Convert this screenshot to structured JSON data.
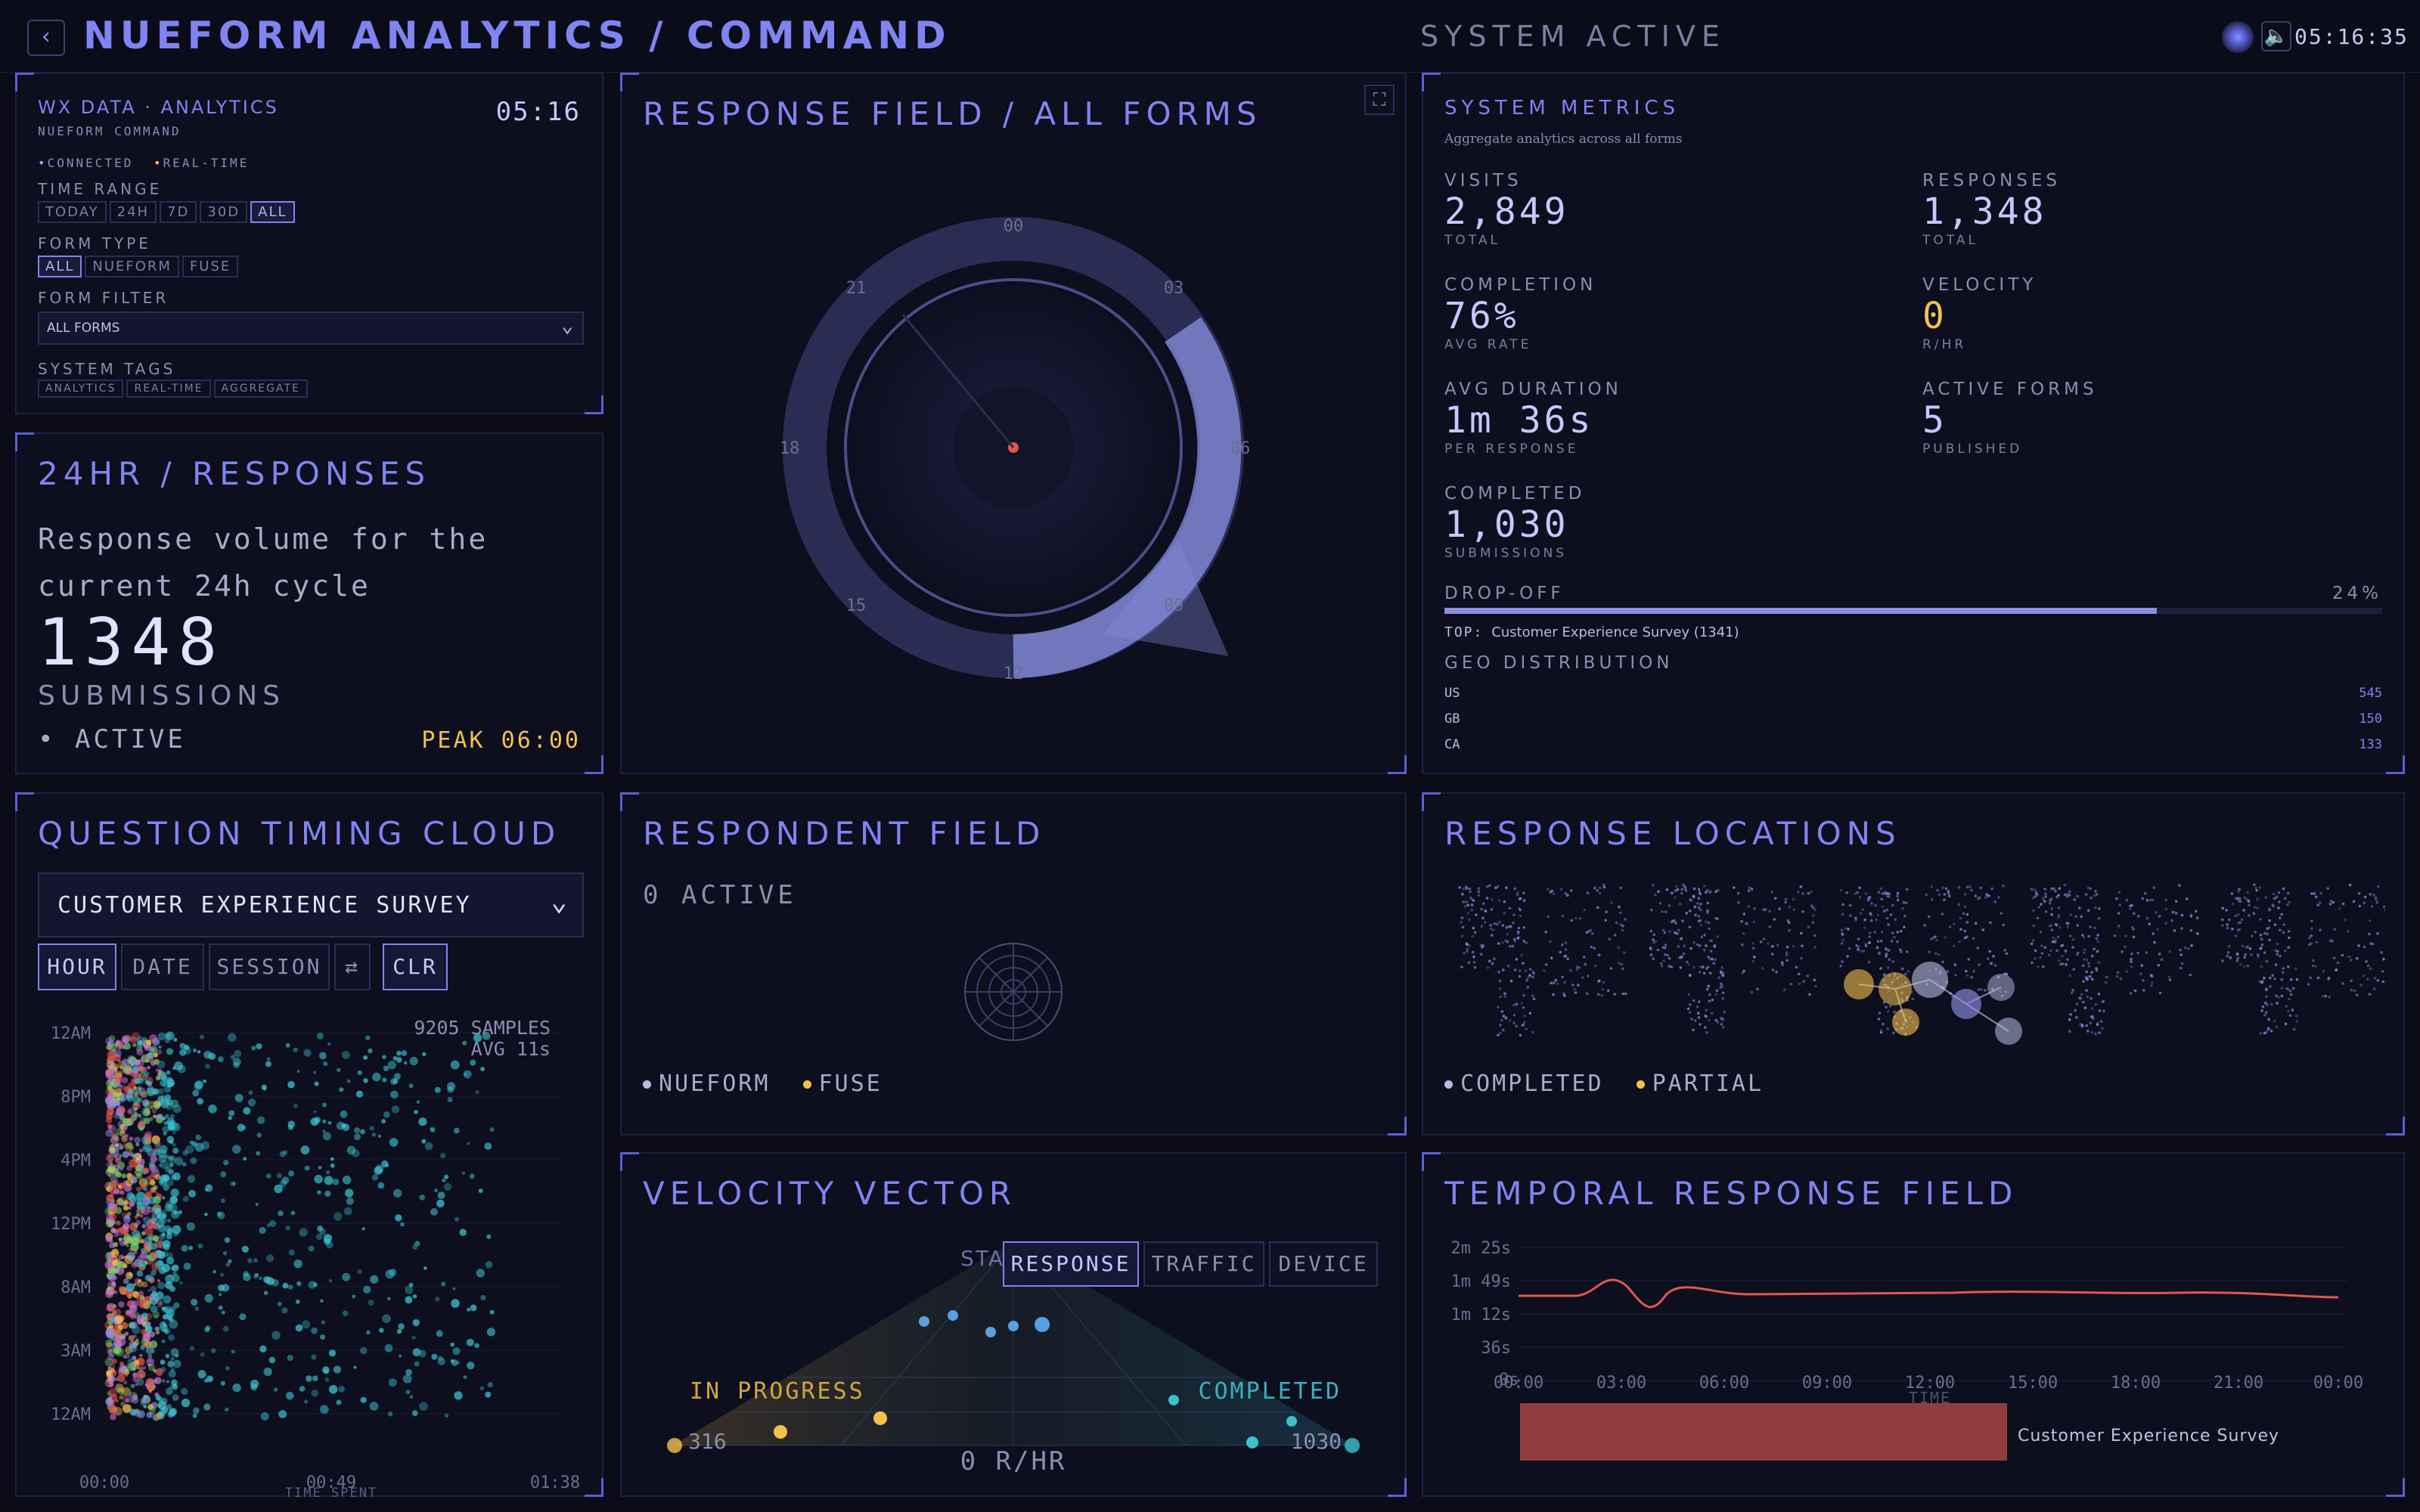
{
  "header": {
    "back_icon": "‹",
    "title": "NUEFORM ANALYTICS / COMMAND",
    "status": "SYSTEM ACTIVE",
    "clock": "05:16:35"
  },
  "control": {
    "title": "WX DATA · ANALYTICS",
    "subtitle": "NUEFORM COMMAND",
    "time": "05:16",
    "status_connected": "CONNECTED",
    "status_realtime": "REAL-TIME",
    "time_range_label": "TIME RANGE",
    "time_ranges": [
      "TODAY",
      "24H",
      "7D",
      "30D",
      "ALL"
    ],
    "form_type_label": "FORM TYPE",
    "form_types": [
      "ALL",
      "NUEFORM",
      "FUSE"
    ],
    "form_filter_label": "FORM FILTER",
    "form_filter_value": "ALL FORMS",
    "tags_label": "SYSTEM TAGS",
    "tags": [
      "ANALYTICS",
      "REAL-TIME",
      "AGGREGATE"
    ]
  },
  "responses24": {
    "title": "24HR / RESPONSES",
    "desc1": "Response volume for the",
    "desc2": "current 24h cycle",
    "count": "1348",
    "unit": "SUBMISSIONS",
    "status": "ACTIVE",
    "peak": "PEAK 06:00"
  },
  "field": {
    "title": "RESPONSE FIELD / ALL FORMS",
    "hours": [
      "00",
      "03",
      "06",
      "09",
      "12",
      "15",
      "18",
      "21"
    ]
  },
  "metrics": {
    "title": "SYSTEM METRICS",
    "subtitle": "Aggregate analytics across all forms",
    "items": [
      {
        "label": "VISITS",
        "value": "2,849",
        "sub": "TOTAL"
      },
      {
        "label": "RESPONSES",
        "value": "1,348",
        "sub": "TOTAL"
      },
      {
        "label": "COMPLETION",
        "value": "76%",
        "sub": "AVG RATE"
      },
      {
        "label": "VELOCITY",
        "value": "0",
        "sub": "R/HR"
      },
      {
        "label": "AVG DURATION",
        "value": "1m 36s",
        "sub": "PER RESPONSE"
      },
      {
        "label": "ACTIVE FORMS",
        "value": "5",
        "sub": "PUBLISHED"
      },
      {
        "label": "COMPLETED",
        "value": "1,030",
        "sub": "SUBMISSIONS"
      }
    ],
    "dropoff_label": "DROP-OFF",
    "dropoff_value": "24%",
    "dropoff_fraction": 0.24,
    "top_label": "TOP:",
    "top_value": "Customer Experience Survey (1341)",
    "geo_label": "GEO DISTRIBUTION",
    "geo": [
      {
        "code": "US",
        "count": "545"
      },
      {
        "code": "GB",
        "count": "150"
      },
      {
        "code": "CA",
        "count": "133"
      }
    ]
  },
  "timing": {
    "title": "QUESTION TIMING CLOUD",
    "survey": "CUSTOMER EXPERIENCE SURVEY",
    "buttons": {
      "hour": "HOUR",
      "date": "DATE",
      "session": "SESSION",
      "swap": "⇄",
      "clr": "CLR"
    },
    "samples": "9205 SAMPLES",
    "avg": "AVG 11s",
    "yticks": [
      "12AM",
      "8PM",
      "4PM",
      "12PM",
      "8AM",
      "3AM",
      "12AM"
    ],
    "xticks": [
      "00:00",
      "00:49",
      "01:38"
    ],
    "xlabel": "TIME SPENT"
  },
  "respondent": {
    "title": "RESPONDENT FIELD",
    "active": "0 ACTIVE",
    "legend_a": "NUEFORM",
    "legend_b": "FUSE"
  },
  "locations": {
    "title": "RESPONSE LOCATIONS",
    "legend_a": "COMPLETED",
    "legend_b": "PARTIAL"
  },
  "velocity": {
    "title": "VELOCITY VECTOR",
    "tabs": [
      "RESPONSE",
      "TRAFFIC",
      "DEVICE"
    ],
    "started": "STARTED",
    "in_progress": "IN PROGRESS",
    "completed": "COMPLETED",
    "in_progress_count": "316",
    "completed_count": "1030",
    "rate": "0 R/HR"
  },
  "temporal": {
    "title": "TEMPORAL RESPONSE FIELD",
    "yticks": [
      "2m 25s",
      "1m 49s",
      "1m 12s",
      "36s",
      "0s"
    ],
    "xticks": [
      "00:00",
      "03:00",
      "06:00",
      "09:00",
      "12:00",
      "15:00",
      "18:00",
      "21:00",
      "00:00"
    ],
    "xlabel": "TIME",
    "bar_label": "Customer Experience Survey"
  },
  "colors": {
    "accent": "#7f84f0",
    "gold": "#f2c14e",
    "teal": "#3cc0cc",
    "red": "#e2574c"
  }
}
